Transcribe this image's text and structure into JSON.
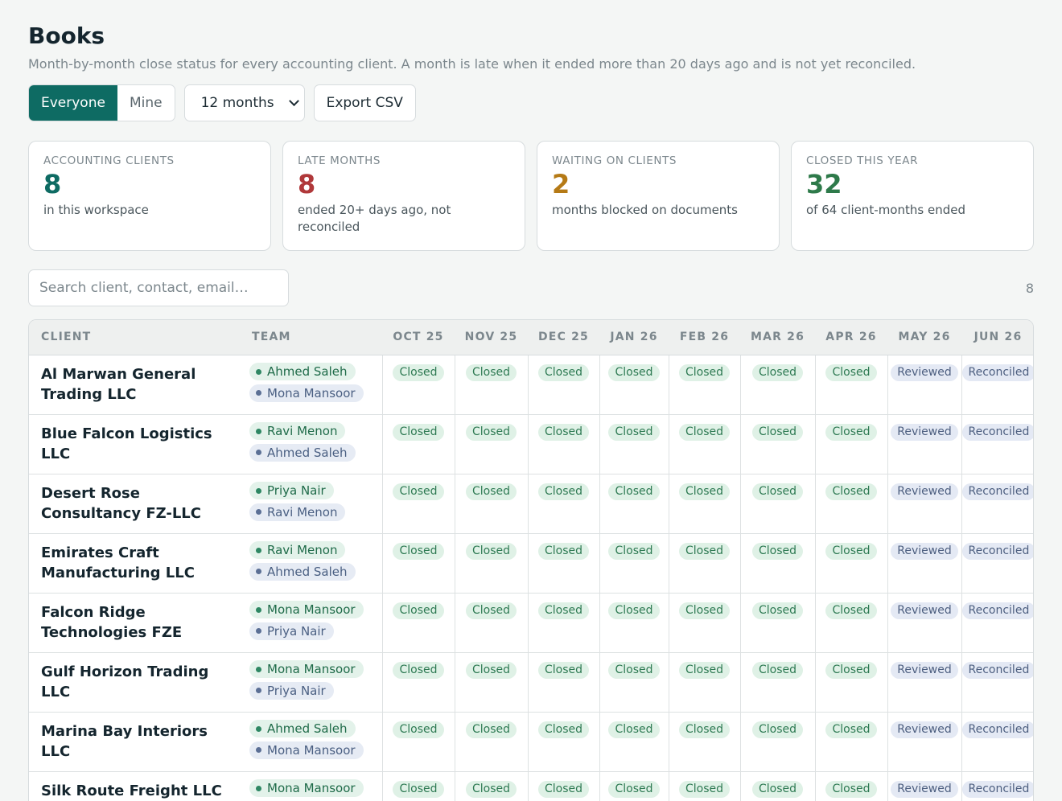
{
  "header": {
    "title": "Books",
    "subtitle": "Month-by-month close status for every accounting client. A month is late when it ended more than 20 days ago and is not yet reconciled."
  },
  "toolbar": {
    "scope": {
      "everyone": "Everyone",
      "mine": "Mine",
      "active": "everyone"
    },
    "range_select": "12 months",
    "export_label": "Export CSV"
  },
  "stats": [
    {
      "label": "ACCOUNTING CLIENTS",
      "value": "8",
      "desc": "in this workspace",
      "color": "#0e6b63"
    },
    {
      "label": "LATE MONTHS",
      "value": "8",
      "desc": "ended 20+ days ago, not reconciled",
      "color": "#b0383a"
    },
    {
      "label": "WAITING ON CLIENTS",
      "value": "2",
      "desc": "months blocked on documents",
      "color": "#b57a16"
    },
    {
      "label": "CLOSED THIS YEAR",
      "value": "32",
      "desc": "of 64 client-months ended",
      "color": "#2e7a4a"
    }
  ],
  "search": {
    "placeholder": "Search client, contact, email…",
    "count": "8"
  },
  "table": {
    "headers": {
      "client": "CLIENT",
      "team": "TEAM"
    },
    "months": [
      "OCT 25",
      "NOV 25",
      "DEC 25",
      "JAN 26",
      "FEB 26",
      "MAR 26",
      "APR 26",
      "MAY 26",
      "JUN 26"
    ],
    "status_labels": {
      "closed": "Closed",
      "reviewed": "Reviewed",
      "reconciled": "Reconciled"
    },
    "rows": [
      {
        "client": "Al Marwan General Trading LLC",
        "team": [
          "Ahmed Saleh",
          "Mona Mansoor"
        ],
        "statuses": [
          "closed",
          "closed",
          "closed",
          "closed",
          "closed",
          "closed",
          "closed",
          "reviewed",
          "reconciled"
        ]
      },
      {
        "client": "Blue Falcon Logistics LLC",
        "team": [
          "Ravi Menon",
          "Ahmed Saleh"
        ],
        "statuses": [
          "closed",
          "closed",
          "closed",
          "closed",
          "closed",
          "closed",
          "closed",
          "reviewed",
          "reconciled"
        ]
      },
      {
        "client": "Desert Rose Consultancy FZ-LLC",
        "team": [
          "Priya Nair",
          "Ravi Menon"
        ],
        "statuses": [
          "closed",
          "closed",
          "closed",
          "closed",
          "closed",
          "closed",
          "closed",
          "reviewed",
          "reconciled"
        ]
      },
      {
        "client": "Emirates Craft Manufacturing LLC",
        "team": [
          "Ravi Menon",
          "Ahmed Saleh"
        ],
        "statuses": [
          "closed",
          "closed",
          "closed",
          "closed",
          "closed",
          "closed",
          "closed",
          "reviewed",
          "reconciled"
        ]
      },
      {
        "client": "Falcon Ridge Technologies FZE",
        "team": [
          "Mona Mansoor",
          "Priya Nair"
        ],
        "statuses": [
          "closed",
          "closed",
          "closed",
          "closed",
          "closed",
          "closed",
          "closed",
          "reviewed",
          "reconciled"
        ]
      },
      {
        "client": "Gulf Horizon Trading LLC",
        "team": [
          "Mona Mansoor",
          "Priya Nair"
        ],
        "statuses": [
          "closed",
          "closed",
          "closed",
          "closed",
          "closed",
          "closed",
          "closed",
          "reviewed",
          "reconciled"
        ]
      },
      {
        "client": "Marina Bay Interiors LLC",
        "team": [
          "Ahmed Saleh",
          "Mona Mansoor"
        ],
        "statuses": [
          "closed",
          "closed",
          "closed",
          "closed",
          "closed",
          "closed",
          "closed",
          "reviewed",
          "reconciled"
        ]
      },
      {
        "client": "Silk Route Freight LLC",
        "team": [
          "Mona Mansoor"
        ],
        "statuses": [
          "closed",
          "closed",
          "closed",
          "closed",
          "closed",
          "closed",
          "closed",
          "reviewed",
          "reconciled"
        ]
      }
    ]
  }
}
